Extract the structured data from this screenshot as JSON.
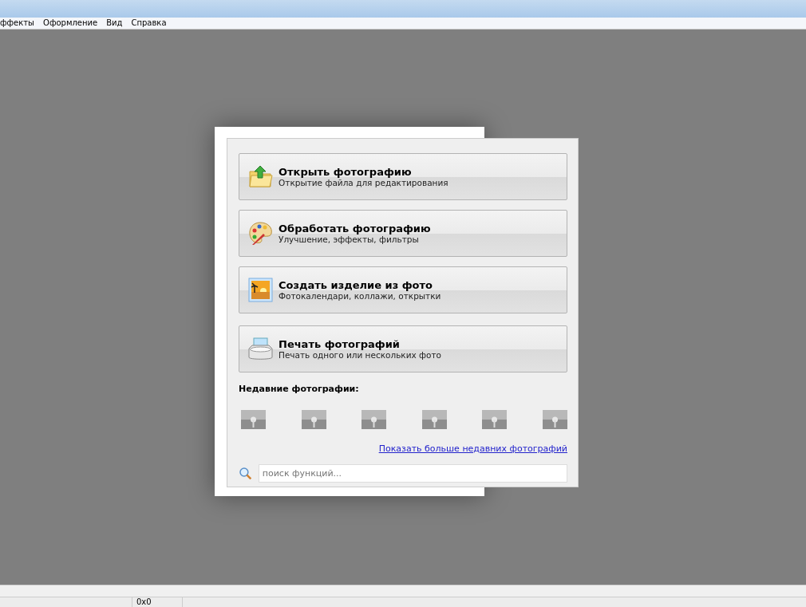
{
  "menu_bar": {
    "items": [
      "ффекты",
      "Оформление",
      "Вид",
      "Справка"
    ]
  },
  "start_dialog": {
    "actions": [
      {
        "kind": "open",
        "title": "Открыть фотографию",
        "subtitle": "Открытие файла для редактирования"
      },
      {
        "kind": "edit",
        "title": "Обработать фотографию",
        "subtitle": "Улучшение, эффекты, фильтры"
      },
      {
        "kind": "create",
        "title": "Создать изделие из фото",
        "subtitle": "Фотокалендари, коллажи, открытки"
      },
      {
        "kind": "print",
        "title": "Печать фотографий",
        "subtitle": "Печать одного или нескольких фото"
      }
    ],
    "recent_label": "Недавние фотографии:",
    "recent_photos": [
      {
        "kind": "photo"
      },
      {
        "kind": "photo"
      },
      {
        "kind": "photo"
      },
      {
        "kind": "photo"
      },
      {
        "kind": "photo"
      },
      {
        "kind": "photo"
      }
    ],
    "more_link": "Показать больше недавних фотографий",
    "search": {
      "placeholder": "поиск функций..."
    }
  },
  "status_bar": {
    "size": "0x0"
  }
}
